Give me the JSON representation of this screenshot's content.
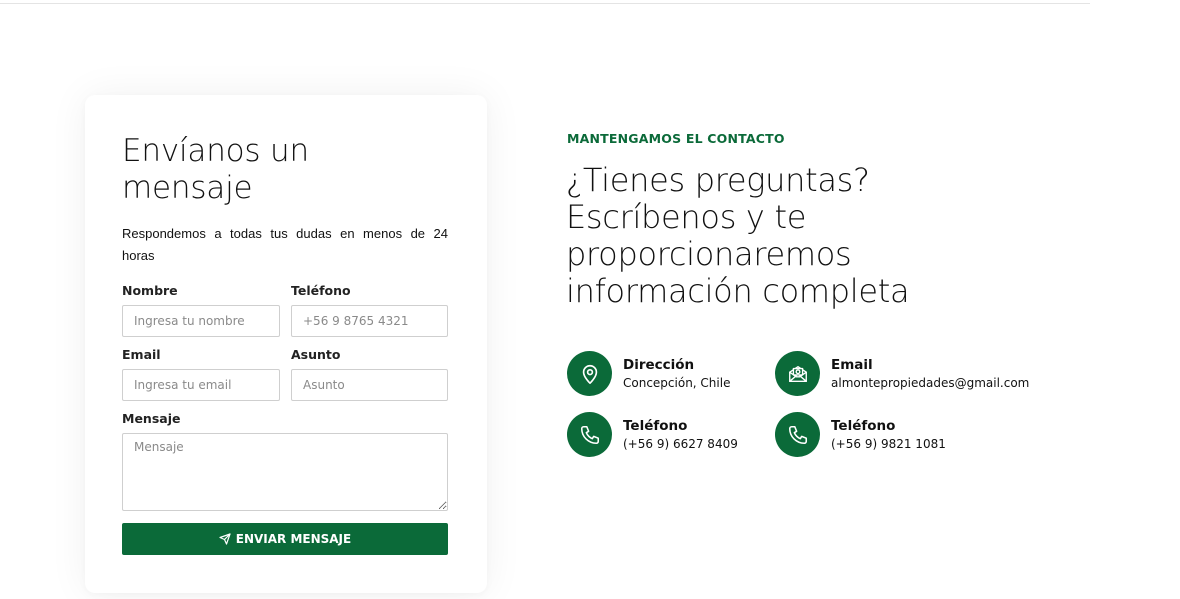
{
  "form": {
    "title": "Envíanos un mensaje",
    "subtitle": "Respondemos a todas tus dudas en menos de 24 horas",
    "fields": {
      "name": {
        "label": "Nombre",
        "placeholder": "Ingresa tu nombre",
        "value": ""
      },
      "phone": {
        "label": "Teléfono",
        "placeholder": "+56 9 8765 4321",
        "value": ""
      },
      "email": {
        "label": "Email",
        "placeholder": "Ingresa tu email",
        "value": ""
      },
      "subject": {
        "label": "Asunto",
        "placeholder": "Asunto",
        "value": ""
      },
      "message": {
        "label": "Mensaje",
        "placeholder": "Mensaje",
        "value": ""
      }
    },
    "submit_label": "ENVIAR MENSAJE",
    "submit_icon": "paper-plane-icon"
  },
  "contact": {
    "eyebrow": "MANTENGAMOS EL CONTACTO",
    "headline": "¿Tienes preguntas? Escríbenos y te proporcionaremos información completa",
    "items": [
      {
        "icon": "location-pin-icon",
        "title": "Dirección",
        "value": "Concepción, Chile"
      },
      {
        "icon": "envelope-icon",
        "title": "Email",
        "value": "almontepropiedades@gmail.com"
      },
      {
        "icon": "phone-icon",
        "title": "Teléfono",
        "value": "(+56 9) 6627 8409"
      },
      {
        "icon": "phone-icon",
        "title": "Teléfono",
        "value": "(+56 9) 9821 1081"
      }
    ]
  },
  "colors": {
    "brand_green": "#0b6a39",
    "text": "#111111",
    "border": "#cfcfcf"
  }
}
